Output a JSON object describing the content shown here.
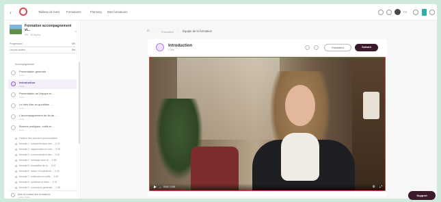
{
  "topbar": {
    "logo_text": "",
    "nav": [
      "Tableau de bord",
      "Formations",
      "Planning",
      "Mes formations"
    ],
    "lang": "FR"
  },
  "sidebar": {
    "course_title": "Formation accompagnement vi...",
    "course_sub": "0% · 12 leçons",
    "progress_label": "Progression",
    "progress_value": "0%",
    "completion_label": "Leçons suivies",
    "completion_value": "0%",
    "section_label": "Accompagnement",
    "lessons": [
      {
        "title": "Présentation générale",
        "sub": "2 min"
      },
      {
        "title": "Introduction",
        "sub": "2 min",
        "active": true
      },
      {
        "title": "Présentation de l'équipe et ...",
        "sub": "3 min"
      },
      {
        "title": "Le bien-être au quotidien ...",
        "sub": "4 min"
      },
      {
        "title": "L'accompagnement de fin de ...",
        "sub": "5 min"
      },
      {
        "title": "Bonnes pratiques, outils et ...",
        "sub": "3 min"
      }
    ],
    "sub_lessons": [
      "Gestion des parcours personnalisés",
      "Module 1 : compréhension des ... 1:20",
      "Module 2 : organisation et suivi ... 2:05",
      "Module 3 : communication des ... 2:40",
      "Module 4 : échange avec le ... 1:55",
      "Module 5 : évaluation de la ... 3:10",
      "Module 6 : retour d'expérience ... 2:30",
      "Module 7 : méthodes et outils ... 1:45",
      "Module 8 : synthèse et bilan ... 2:15",
      "Module 9 : conclusion générale ... 1:30"
    ],
    "footer_title": "Aide et contact des formateurs",
    "footer_sub": "Centre d'aide"
  },
  "main": {
    "breadcrumb_mid": "Formation",
    "breadcrumb_current": "Équipe de la formation",
    "lesson_title": "Introduction",
    "lesson_sub": "2 min",
    "prev_label": "Précédent",
    "next_label": "Suivant",
    "video_time": "00:00 / 2:08"
  },
  "support_label": "Support",
  "colors": {
    "accent": "#3b1a2c",
    "lesson_active": "#8a5fc7",
    "logo": "#e0474c"
  }
}
